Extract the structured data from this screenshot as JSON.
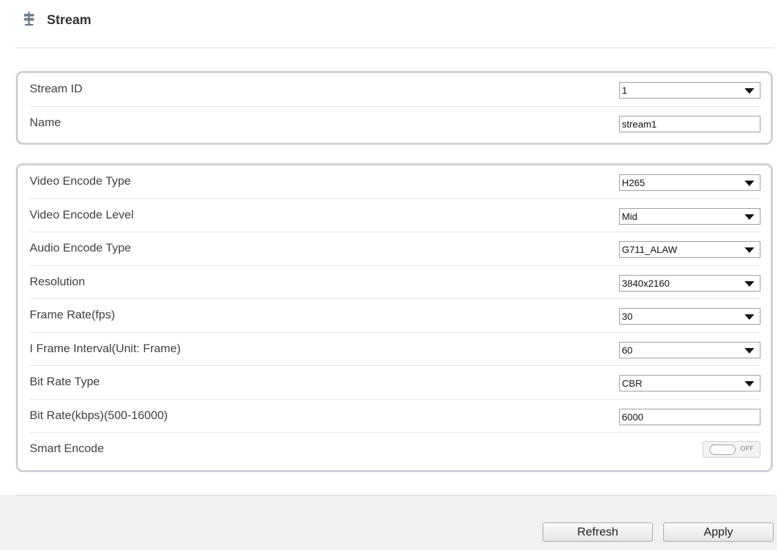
{
  "header": {
    "title": "Stream",
    "icon": "signpost-icon"
  },
  "basic": {
    "stream_id": {
      "label": "Stream ID",
      "value": "1"
    },
    "name": {
      "label": "Name",
      "value": "stream1"
    }
  },
  "encode": {
    "video_encode_type": {
      "label": "Video Encode Type",
      "value": "H265"
    },
    "video_encode_level": {
      "label": "Video Encode Level",
      "value": "Mid"
    },
    "audio_encode_type": {
      "label": "Audio Encode Type",
      "value": "G711_ALAW"
    },
    "resolution": {
      "label": "Resolution",
      "value": "3840x2160"
    },
    "frame_rate": {
      "label": "Frame Rate(fps)",
      "value": "30"
    },
    "i_frame_interval": {
      "label": "I Frame Interval(Unit: Frame)",
      "value": "60"
    },
    "bit_rate_type": {
      "label": "Bit Rate Type",
      "value": "CBR"
    },
    "bit_rate": {
      "label": "Bit Rate(kbps)(500-16000)",
      "value": "6000"
    },
    "smart_encode": {
      "label": "Smart Encode",
      "state": "OFF"
    }
  },
  "footer": {
    "refresh_label": "Refresh",
    "apply_label": "Apply"
  }
}
